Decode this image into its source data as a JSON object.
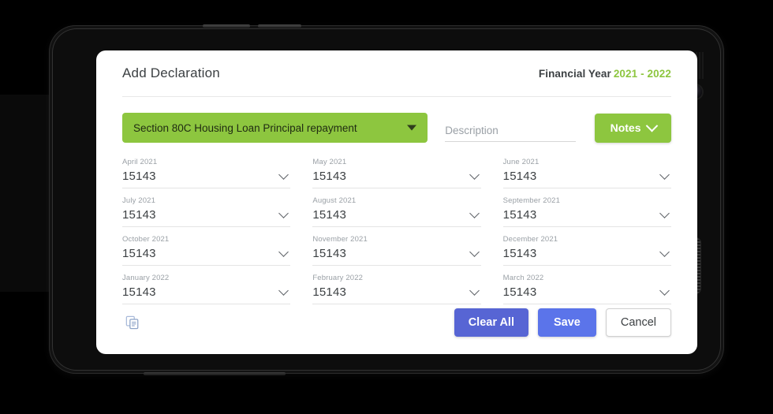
{
  "window": {
    "background_color": "#000000",
    "device_frame_color": "#121212"
  },
  "card": {
    "title": "Add Declaration",
    "financial_year_label": "Financial Year",
    "financial_year_value": "2021 - 2022",
    "accent_green": "#8dc63f"
  },
  "toolbar": {
    "declaration_select_value": "Section 80C Housing Loan Principal repayment",
    "description_placeholder": "Description",
    "description_value": "",
    "notes_label": "Notes",
    "notes_caret_icon": "chevron-down-icon",
    "select_caret_icon": "caret-down-icon"
  },
  "months": [
    {
      "label": "April 2021",
      "value": "15143",
      "caret_icon": "chevron-down-icon"
    },
    {
      "label": "May 2021",
      "value": "15143",
      "caret_icon": "chevron-down-icon"
    },
    {
      "label": "June 2021",
      "value": "15143",
      "caret_icon": "chevron-down-icon"
    },
    {
      "label": "July 2021",
      "value": "15143",
      "caret_icon": "chevron-down-icon"
    },
    {
      "label": "August 2021",
      "value": "15143",
      "caret_icon": "chevron-down-icon"
    },
    {
      "label": "September 2021",
      "value": "15143",
      "caret_icon": "chevron-down-icon"
    },
    {
      "label": "October 2021",
      "value": "15143",
      "caret_icon": "chevron-down-icon"
    },
    {
      "label": "November 2021",
      "value": "15143",
      "caret_icon": "chevron-down-icon"
    },
    {
      "label": "December 2021",
      "value": "15143",
      "caret_icon": "chevron-down-icon"
    },
    {
      "label": "January 2022",
      "value": "15143",
      "caret_icon": "chevron-down-icon"
    },
    {
      "label": "February 2022",
      "value": "15143",
      "caret_icon": "chevron-down-icon"
    },
    {
      "label": "March 2022",
      "value": "15143",
      "caret_icon": "chevron-down-icon"
    }
  ],
  "footer": {
    "copy_icon": "copy-icon",
    "clear_all_label": "Clear All",
    "clear_all_color": "#5765d4",
    "save_label": "Save",
    "save_color": "#5b74ea",
    "cancel_label": "Cancel"
  }
}
